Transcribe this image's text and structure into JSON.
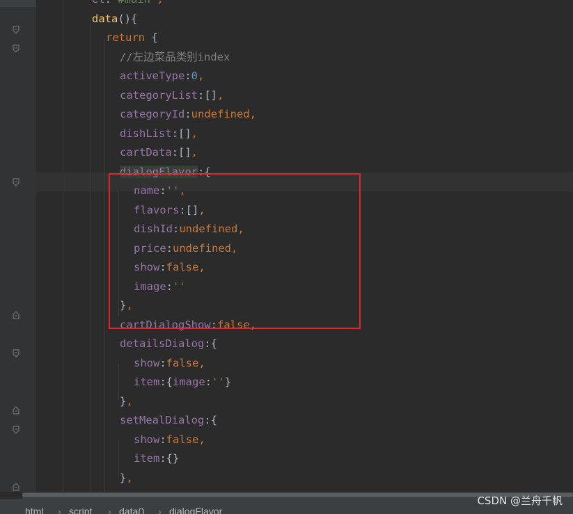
{
  "editor": {
    "lines": [
      {
        "tokens": [
          {
            "t": "el",
            "c": "prop"
          },
          {
            "t": ":",
            "c": "pun"
          },
          {
            "t": "'#main'",
            "c": "str"
          },
          {
            "t": ",",
            "c": "kw"
          }
        ]
      },
      {
        "tokens": [
          {
            "t": "data",
            "c": "fn"
          },
          {
            "t": "(){",
            "c": "pun"
          }
        ]
      },
      {
        "tokens": [
          {
            "t": "return",
            "c": "kw"
          },
          {
            "t": " {",
            "c": "pun"
          }
        ]
      },
      {
        "tokens": [
          {
            "t": "//左边菜品类别index",
            "c": "cmt"
          }
        ]
      },
      {
        "tokens": [
          {
            "t": "activeType",
            "c": "prop"
          },
          {
            "t": ":",
            "c": "pun"
          },
          {
            "t": "0",
            "c": "num"
          },
          {
            "t": ",",
            "c": "kw"
          }
        ]
      },
      {
        "tokens": [
          {
            "t": "categoryList",
            "c": "prop"
          },
          {
            "t": ":[]",
            "c": "pun"
          },
          {
            "t": ",",
            "c": "kw"
          }
        ]
      },
      {
        "tokens": [
          {
            "t": "categoryId",
            "c": "prop"
          },
          {
            "t": ":",
            "c": "pun"
          },
          {
            "t": "undefined",
            "c": "kw"
          },
          {
            "t": ",",
            "c": "kw"
          }
        ]
      },
      {
        "tokens": [
          {
            "t": "dishList",
            "c": "prop"
          },
          {
            "t": ":[]",
            "c": "pun"
          },
          {
            "t": ",",
            "c": "kw"
          }
        ]
      },
      {
        "tokens": [
          {
            "t": "cartData",
            "c": "prop"
          },
          {
            "t": ":[]",
            "c": "pun"
          },
          {
            "t": ",",
            "c": "kw"
          }
        ]
      },
      {
        "tokens": [
          {
            "t": "dialogFlavor",
            "c": "prop hl-name"
          },
          {
            "t": ":{",
            "c": "pun"
          }
        ]
      },
      {
        "tokens": [
          {
            "t": "name",
            "c": "prop"
          },
          {
            "t": ":",
            "c": "pun"
          },
          {
            "t": "''",
            "c": "str"
          },
          {
            "t": ",",
            "c": "kw"
          }
        ]
      },
      {
        "tokens": [
          {
            "t": "flavors",
            "c": "prop"
          },
          {
            "t": ":[]",
            "c": "pun"
          },
          {
            "t": ",",
            "c": "kw"
          }
        ]
      },
      {
        "tokens": [
          {
            "t": "dishId",
            "c": "prop"
          },
          {
            "t": ":",
            "c": "pun"
          },
          {
            "t": "undefined",
            "c": "kw"
          },
          {
            "t": ",",
            "c": "kw"
          }
        ]
      },
      {
        "tokens": [
          {
            "t": "price",
            "c": "prop"
          },
          {
            "t": ":",
            "c": "pun"
          },
          {
            "t": "undefined",
            "c": "kw"
          },
          {
            "t": ",",
            "c": "kw"
          }
        ]
      },
      {
        "tokens": [
          {
            "t": "show",
            "c": "prop"
          },
          {
            "t": ":",
            "c": "pun"
          },
          {
            "t": "false",
            "c": "kw"
          },
          {
            "t": ",",
            "c": "kw"
          }
        ]
      },
      {
        "tokens": [
          {
            "t": "image",
            "c": "prop"
          },
          {
            "t": ":",
            "c": "pun"
          },
          {
            "t": "''",
            "c": "str"
          }
        ]
      },
      {
        "tokens": [
          {
            "t": "}",
            "c": "pun"
          },
          {
            "t": ",",
            "c": "kw"
          }
        ]
      },
      {
        "tokens": [
          {
            "t": "cartDialogShow",
            "c": "prop"
          },
          {
            "t": ":",
            "c": "pun"
          },
          {
            "t": "false",
            "c": "kw"
          },
          {
            "t": ",",
            "c": "kw"
          }
        ]
      },
      {
        "tokens": [
          {
            "t": "detailsDialog",
            "c": "prop"
          },
          {
            "t": ":{",
            "c": "pun"
          }
        ]
      },
      {
        "tokens": [
          {
            "t": "show",
            "c": "prop"
          },
          {
            "t": ":",
            "c": "pun"
          },
          {
            "t": "false",
            "c": "kw"
          },
          {
            "t": ",",
            "c": "kw"
          }
        ]
      },
      {
        "tokens": [
          {
            "t": "item",
            "c": "prop"
          },
          {
            "t": ":{",
            "c": "pun"
          },
          {
            "t": "image",
            "c": "prop"
          },
          {
            "t": ":",
            "c": "pun"
          },
          {
            "t": "''",
            "c": "str"
          },
          {
            "t": "}",
            "c": "pun"
          }
        ]
      },
      {
        "tokens": [
          {
            "t": "}",
            "c": "pun"
          },
          {
            "t": ",",
            "c": "kw"
          }
        ]
      },
      {
        "tokens": [
          {
            "t": "setMealDialog",
            "c": "prop"
          },
          {
            "t": ":{",
            "c": "pun"
          }
        ]
      },
      {
        "tokens": [
          {
            "t": "show",
            "c": "prop"
          },
          {
            "t": ":",
            "c": "pun"
          },
          {
            "t": "false",
            "c": "kw"
          },
          {
            "t": ",",
            "c": "kw"
          }
        ]
      },
      {
        "tokens": [
          {
            "t": "item",
            "c": "prop"
          },
          {
            "t": ":{}",
            "c": "pun"
          }
        ]
      },
      {
        "tokens": [
          {
            "t": "}",
            "c": "pun"
          },
          {
            "t": ",",
            "c": "kw"
          }
        ]
      }
    ]
  },
  "breadcrumb": [
    "html",
    "script",
    "data()",
    "dialogFlavor"
  ],
  "watermark": "CSDN @兰舟千帆",
  "colors": {
    "background": "#2b2b2b",
    "keyword": "#cc7832",
    "function": "#ffc66d",
    "property": "#9876aa",
    "number": "#6897bb",
    "string": "#6a8759",
    "comment": "#808080",
    "highlight_box": "#e0262c"
  }
}
